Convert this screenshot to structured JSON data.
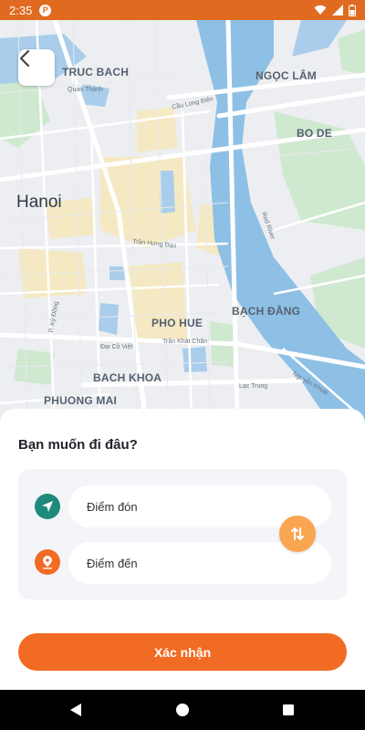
{
  "status_bar": {
    "time": "2:35",
    "app_icon": "P",
    "icons": [
      "app-notification-icon",
      "wifi-icon",
      "signal-icon",
      "battery-icon"
    ]
  },
  "map": {
    "labels": {
      "truc_bach": "TRUC BACH",
      "quan_thanh": "Quán Thánh",
      "cau_long_bien": "Cầu Long Biên",
      "ngoc_lam": "NGỌC LÂM",
      "bo_de": "BO DE",
      "hanoi": "Hanoi",
      "red_river": "Red River",
      "tran_hung_dao": "Trần Hưng Đạo",
      "pho_hue": "PHO HUE",
      "bach_dang": "BẠCH ĐẰNG",
      "p_ky_dong": "P. Kỳ Đồng",
      "dai_co_viet": "Đại Cồ Việt",
      "tran_khat_chan": "Trần Khát Chân",
      "bach_khoa": "BACH KHOA",
      "lac_trung": "Lạc Trung",
      "nguyen_khoai": "Nguyễn Khoái",
      "phuong_mai": "PHUONG MAI"
    }
  },
  "sheet": {
    "title": "Bạn muốn đi đâu?",
    "pickup_label": "Điểm đón",
    "destination_label": "Điểm đến",
    "confirm_label": "Xác nhận"
  },
  "colors": {
    "brand_orange": "#F26B24",
    "status_bar": "#E06A1F",
    "pickup_teal": "#1F8A7C",
    "swap_orange": "#F9A551",
    "river": "#8EC0E6"
  }
}
